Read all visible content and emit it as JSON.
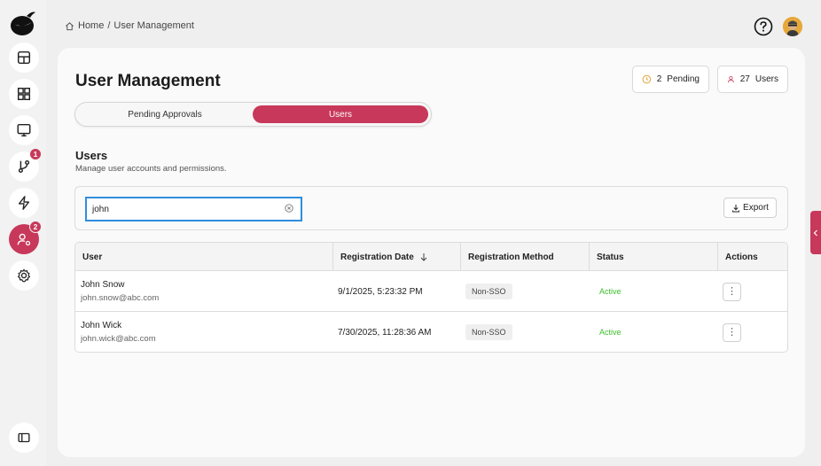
{
  "breadcrumb": {
    "home": "Home",
    "separator": "/",
    "current": "User Management"
  },
  "sidebar": {
    "items": [
      {
        "icon": "layout-icon",
        "badge": ""
      },
      {
        "icon": "grid-icon",
        "badge": ""
      },
      {
        "icon": "monitor-icon",
        "badge": ""
      },
      {
        "icon": "branch-icon",
        "badge": "1"
      },
      {
        "icon": "lightning-icon",
        "badge": ""
      },
      {
        "icon": "user-settings-icon",
        "badge": "2",
        "active": true
      },
      {
        "icon": "gear-icon",
        "badge": ""
      }
    ],
    "collapse_icon": "sidebar-toggle-icon"
  },
  "page": {
    "title": "User Management",
    "pending_count": "2",
    "pending_label": "Pending",
    "users_count": "27",
    "users_label": "Users"
  },
  "tabs": [
    {
      "label": "Pending Approvals",
      "active": false
    },
    {
      "label": "Users",
      "active": true
    }
  ],
  "section": {
    "title": "Users",
    "subtitle": "Manage user accounts and permissions."
  },
  "search": {
    "value": "john",
    "placeholder": ""
  },
  "export_label": "Export",
  "table": {
    "columns": [
      "User",
      "Registration Date",
      "Registration Method",
      "Status",
      "Actions"
    ],
    "rows": [
      {
        "name": "John Snow",
        "email": "john.snow@abc.com",
        "date": "9/1/2025, 5:23:32 PM",
        "method": "Non-SSO",
        "status": "Active",
        "action": "⋮"
      },
      {
        "name": "John Wick",
        "email": "john.wick@abc.com",
        "date": "7/30/2025, 11:28:36 AM",
        "method": "Non-SSO",
        "status": "Active",
        "action": "⋮"
      }
    ]
  },
  "colors": {
    "accent": "#c8385a",
    "active_status": "#3cbf2a",
    "focus": "#2f8ddd"
  }
}
